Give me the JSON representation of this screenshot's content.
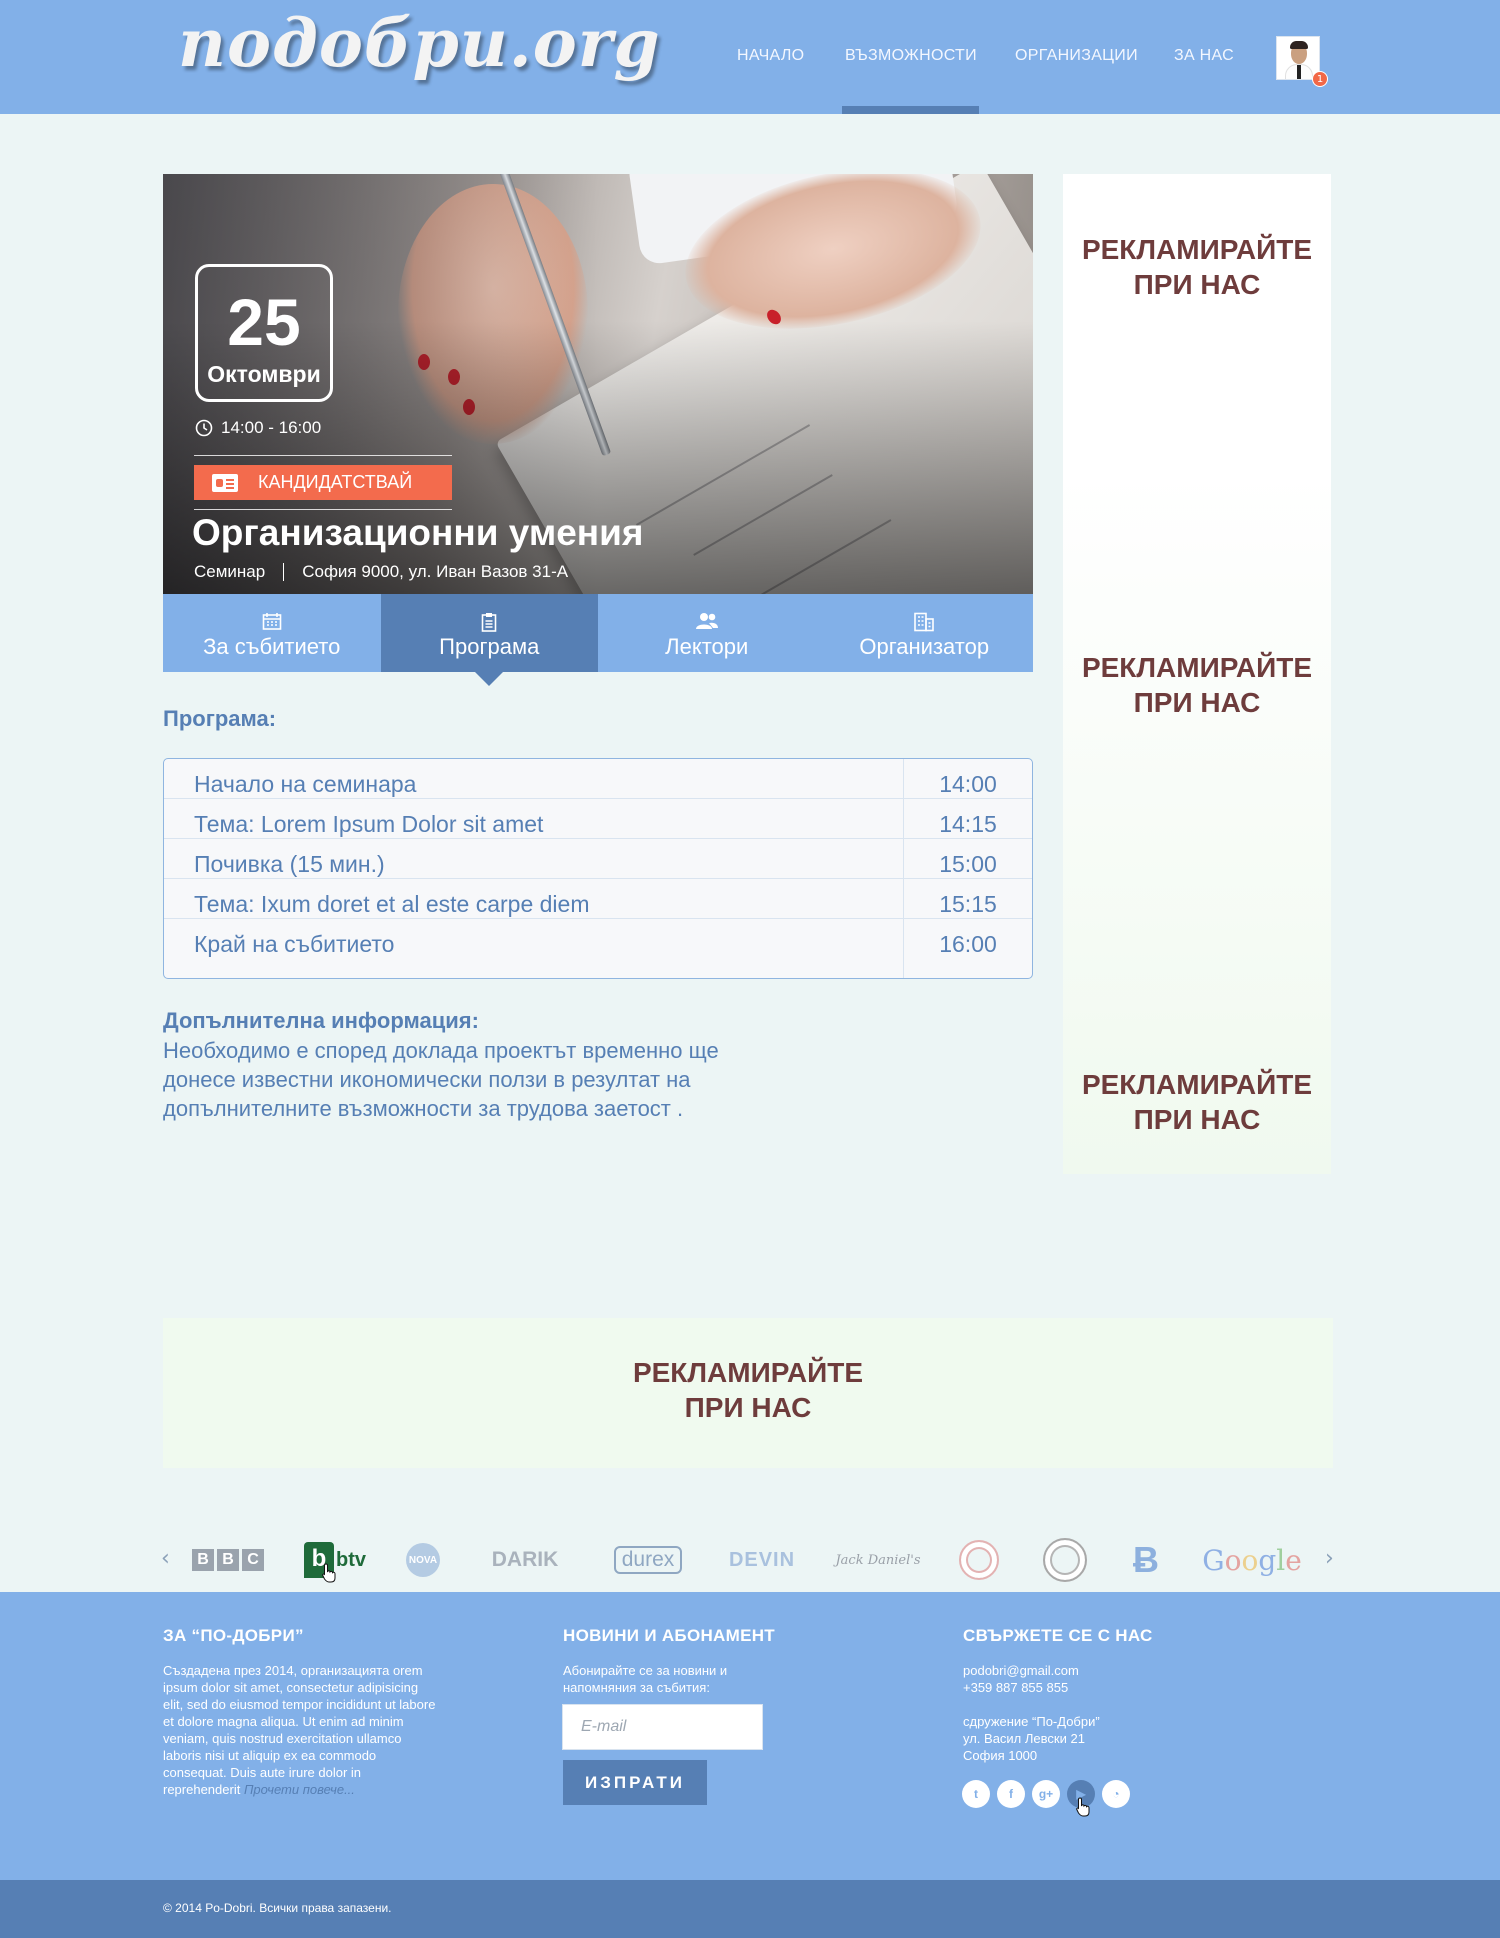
{
  "header": {
    "logo": "подобри.org",
    "nav": [
      {
        "label": "НАЧАЛО",
        "active": false
      },
      {
        "label": "ВЪЗМОЖНОСТИ",
        "active": true
      },
      {
        "label": "ОРГАНИЗАЦИИ",
        "active": false
      },
      {
        "label": "ЗА НАС",
        "active": false
      }
    ],
    "notification_count": "1"
  },
  "event": {
    "day": "25",
    "month": "Октомври",
    "time": "14:00 - 16:00",
    "apply_label": "КАНДИДАТСТВАЙ",
    "title": "Организационни умения",
    "type": "Семинар",
    "address": "София 9000, ул. Иван Вазов 31-А"
  },
  "tabs": [
    {
      "label": "За събитието",
      "icon": "calendar-icon",
      "active": false
    },
    {
      "label": "Програма",
      "icon": "clipboard-icon",
      "active": true
    },
    {
      "label": "Лектори",
      "icon": "users-icon",
      "active": false
    },
    {
      "label": "Организатор",
      "icon": "building-icon",
      "active": false
    }
  ],
  "program": {
    "title": "Програма:",
    "rows": [
      {
        "name": "Начало на семинара",
        "time": "14:00"
      },
      {
        "name": "Тема: Lorem Ipsum Dolor sit amet",
        "time": "14:15"
      },
      {
        "name": "Почивка (15 мин.)",
        "time": "15:00"
      },
      {
        "name": "Тема: Ixum doret et al este carpe diem",
        "time": "15:15"
      },
      {
        "name": "Край на събитието",
        "time": "16:00"
      }
    ]
  },
  "extra": {
    "title": "Допълнителна информация:",
    "text": "Необходимо е според доклада проектът временно ще донесе известни икономически ползи в резултат на допълнителните възможности за трудова заетост ."
  },
  "ads": {
    "line1": "РЕКЛАМИРАЙТЕ",
    "line2": "ПРИ НАС"
  },
  "partners": {
    "prev": "‹",
    "next": "›",
    "logos": [
      "BBC",
      "btv",
      "NOVA",
      "DARIK",
      "durex",
      "DEVIN",
      "Jack Daniel's",
      "seal-1",
      "seal-2",
      "pharmacy",
      "Google"
    ]
  },
  "footer": {
    "about_title": "ЗА “ПО-ДОБРИ”",
    "about_text": "Създадена през 2014, организацията orem ipsum dolor sit amet, consectetur adipisicing elit, sed do eiusmod tempor incididunt ut labore et dolore magna aliqua. Ut enim ad minim veniam, quis nostrud exercitation ullamco laboris nisi ut aliquip ex ea commodo consequat. Duis aute irure dolor in reprehenderit",
    "read_more": "Прочети повече...",
    "news_title": "НОВИНИ И АБОНАМЕНТ",
    "news_text": "Абонирайте се за новини и напомняния за събития:",
    "email_placeholder": "E-mail",
    "send_label": "ИЗПРАТИ",
    "contact_title": "СВЪРЖЕТЕ СЕ С НАС",
    "email": "podobri@gmail.com",
    "phone": "+359 887 855 855",
    "org": "сдружение “По-Добри”",
    "street": "ул. Васил Левски 21",
    "city": "София 1000",
    "social": [
      "twitter-icon",
      "facebook-icon",
      "google-plus-icon",
      "youtube-icon",
      "rss-icon"
    ],
    "copyright": "© 2014 Po-Dobri. Всички права запазени."
  },
  "colors": {
    "header_bg": "#82b0e8",
    "accent_dark": "#567fb4",
    "apply": "#f36b4d",
    "ad_text": "#6e3c3c"
  }
}
